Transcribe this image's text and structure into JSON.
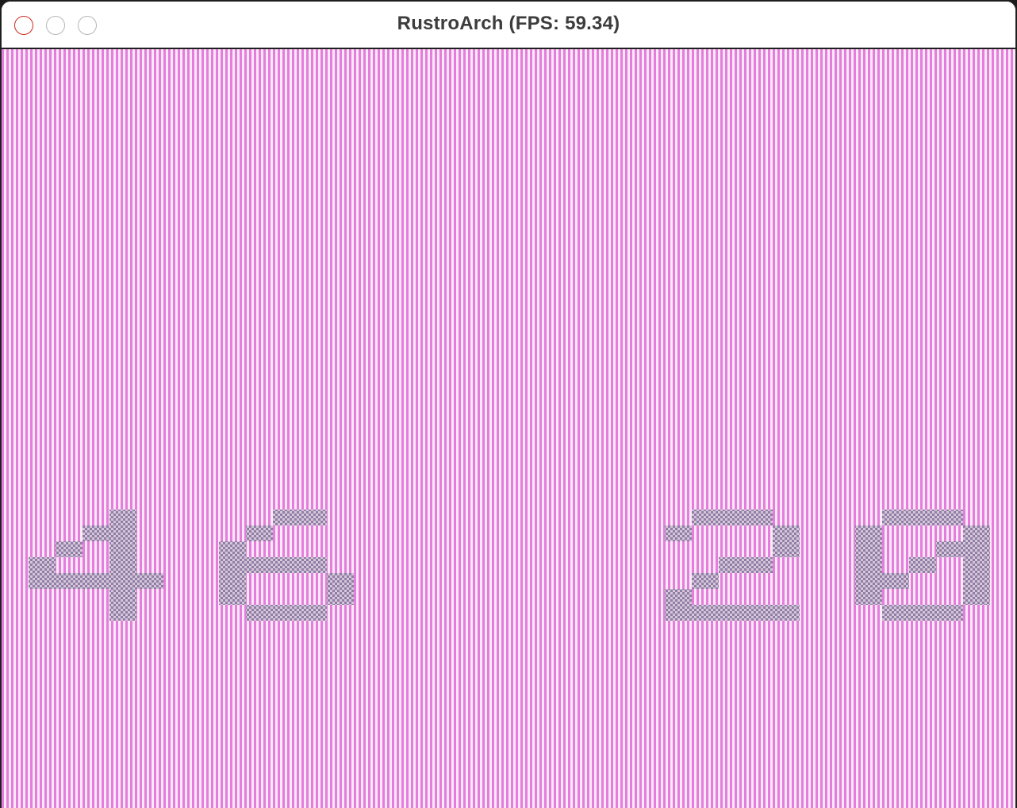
{
  "window": {
    "title": "RustroArch (FPS: 59.34)"
  },
  "colors": {
    "stripe_primary": "#e47ddd",
    "stripe_secondary": "#fbe9f6",
    "pixel_dark": "#8f7fa6",
    "pixel_light": "#d7c6d9",
    "close_button": "#e0352a",
    "inactive_button": "#d8d8d8"
  },
  "icons": {
    "close": "close-icon",
    "minimize": "minimize-icon",
    "maximize": "maximize-icon"
  },
  "game": {
    "scores": {
      "left": "46",
      "right": "20"
    }
  }
}
